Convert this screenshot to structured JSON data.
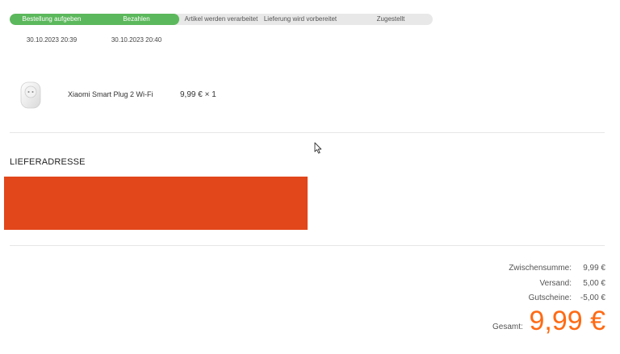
{
  "progress": {
    "steps": [
      {
        "label": "Bestellung aufgeben",
        "done": true
      },
      {
        "label": "Bezahlen",
        "done": true
      },
      {
        "label": "Artikel werden verarbeitet",
        "done": false
      },
      {
        "label": "Lieferung wird vorbereitet",
        "done": false
      },
      {
        "label": "Zugestellt",
        "done": false
      }
    ],
    "dates": [
      "30.10.2023 20:39",
      "30.10.2023 20:40"
    ],
    "completed_color": "#5cb85c",
    "pending_color": "#e8e8e8"
  },
  "product": {
    "icon": "smart-plug-image",
    "name": "Xiaomi Smart Plug 2 Wi-Fi",
    "price_qty": "9,99 € × 1"
  },
  "address": {
    "title": "LIEFERADRESSE",
    "redaction_color": "#e2461b"
  },
  "summary": {
    "subtotal_label": "Zwischensumme:",
    "subtotal_value": "9,99 €",
    "shipping_label": "Versand:",
    "shipping_value": "5,00 €",
    "coupons_label": "Gutscheine:",
    "coupons_value": "-5,00 €",
    "total_label": "Gesamt:",
    "total_value": "9,99 €",
    "total_color": "#ff6a13"
  }
}
